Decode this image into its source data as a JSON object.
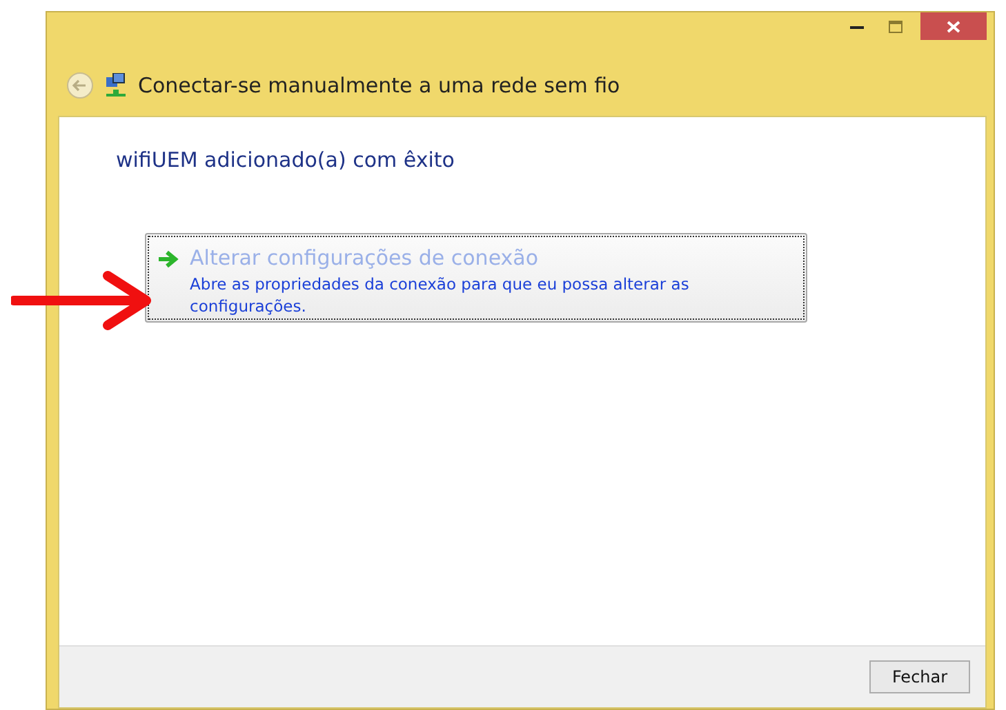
{
  "window": {
    "title": "Conectar-se manualmente a uma rede sem fio"
  },
  "message": "wifiUEM adicionado(a) com êxito",
  "command_link": {
    "title": "Alterar configurações de conexão",
    "description": "Abre as propriedades da conexão para que eu possa alterar as configurações."
  },
  "buttons": [
    {
      "label": "Fechar"
    }
  ]
}
